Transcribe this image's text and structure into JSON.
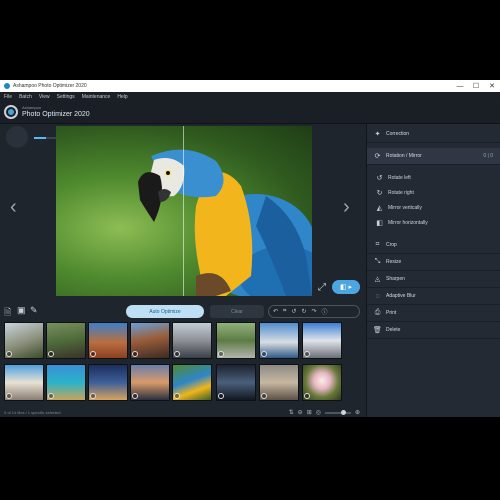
{
  "window": {
    "title": "Ashampoo Photo Optimizer 2020",
    "controls": [
      "—",
      "☐",
      "✕"
    ]
  },
  "menu": [
    "File",
    "Batch",
    "View",
    "Settings",
    "Maintenance",
    "Help"
  ],
  "brand": {
    "small": "Ashampoo",
    "big": "Photo Optimizer 2020"
  },
  "toolbar": {
    "auto_optimize_label": "Auto Optimize",
    "clear_label": "Clear"
  },
  "sidebar": {
    "items": [
      {
        "label": "Correction",
        "icon": "sparkle-icon"
      },
      {
        "label": "Rotation / Mirror",
        "icon": "rotate-icon"
      }
    ],
    "rotation_counts": "0 | 0",
    "sub_items": [
      {
        "label": "Rotate left",
        "icon": "rotate-left-icon"
      },
      {
        "label": "Rotate right",
        "icon": "rotate-right-icon"
      },
      {
        "label": "Mirror vertically",
        "icon": "mirror-vertical-icon"
      },
      {
        "label": "Mirror horizontally",
        "icon": "mirror-horizontal-icon"
      }
    ],
    "tools": [
      {
        "label": "Crop",
        "icon": "crop-icon"
      },
      {
        "label": "Resize",
        "icon": "resize-icon"
      },
      {
        "label": "Sharpen",
        "icon": "sharpen-icon"
      },
      {
        "label": "Adaptive Blur",
        "icon": "blur-icon"
      },
      {
        "label": "Print",
        "icon": "print-icon"
      },
      {
        "label": "Delete",
        "icon": "delete-icon"
      }
    ]
  },
  "status": {
    "text": "0 of 14 files / 1 specific selected"
  },
  "colors": {
    "accent": "#4da6e0",
    "window_bg": "#1b2129",
    "panel_bg": "#232a33"
  }
}
